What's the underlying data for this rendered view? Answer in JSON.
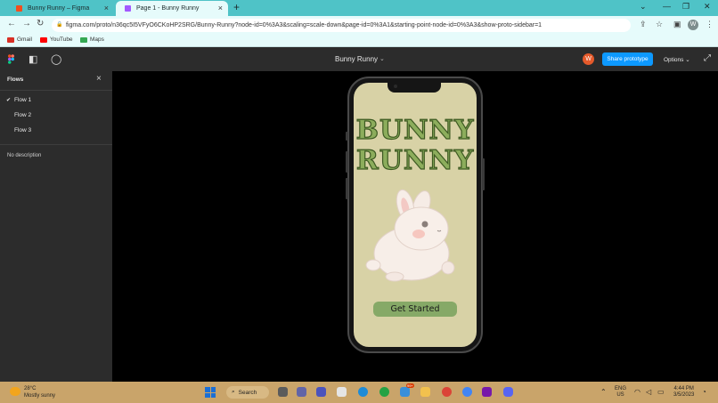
{
  "browser": {
    "tabs": [
      {
        "title": "Bunny Runny – Figma",
        "active": false
      },
      {
        "title": "Page 1 - Bunny Runny",
        "active": true
      }
    ],
    "url": "figma.com/proto/n36qc5I5VFyO6CKoHP2SRG/Bunny-Runny?node-id=0%3A3&scaling=scale-down&page-id=0%3A1&starting-point-node-id=0%3A3&show-proto-sidebar=1",
    "profile_initial": "W",
    "bookmarks": [
      {
        "label": "Gmail",
        "color": "#d93025"
      },
      {
        "label": "YouTube",
        "color": "#ff0000"
      },
      {
        "label": "Maps",
        "color": "#34a853"
      }
    ]
  },
  "figma": {
    "file_title": "Bunny Runny",
    "user_initial": "W",
    "share_label": "Share prototype",
    "options_label": "Options",
    "accent_color": "#0d99ff"
  },
  "sidebar": {
    "title": "Flows",
    "flows": [
      {
        "label": "Flow 1",
        "selected": true
      },
      {
        "label": "Flow 2",
        "selected": false
      },
      {
        "label": "Flow 3",
        "selected": false
      }
    ],
    "description": "No description"
  },
  "prototype": {
    "title_line1": "BUNNY",
    "title_line2": "RUNNY",
    "cta_label": "Get Started",
    "background_color": "#d8d2a6",
    "button_color": "#86a967"
  },
  "taskbar": {
    "weather_temp": "28°C",
    "weather_desc": "Mostly sunny",
    "search_label": "Search",
    "lang_line1": "ENG",
    "lang_line2": "US",
    "time": "4:44 PM",
    "date": "3/5/2023",
    "notification_badge": "99+"
  }
}
